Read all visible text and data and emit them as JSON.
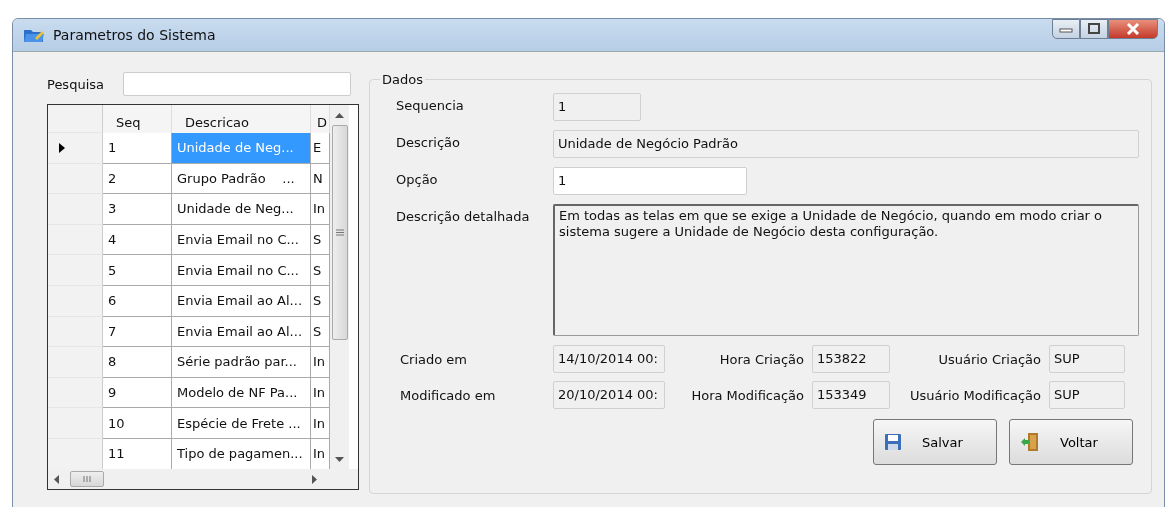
{
  "window": {
    "title": "Parametros do Sistema"
  },
  "search": {
    "label": "Pesquisa"
  },
  "grid": {
    "columns": [
      "Seq",
      "Descricao",
      "D"
    ],
    "rows": [
      {
        "seq": "1",
        "descricao": "Unidade de Neg...",
        "column_3": "E",
        "selected": true
      },
      {
        "seq": "2",
        "descricao": "Grupo Padrão    ...",
        "column_3": "N",
        "selected": false
      },
      {
        "seq": "3",
        "descricao": "Unidade de Neg...",
        "column_3": "In",
        "selected": false
      },
      {
        "seq": "4",
        "descricao": "Envia Email no C...",
        "column_3": "S",
        "selected": false
      },
      {
        "seq": "5",
        "descricao": "Envia Email no C...",
        "column_3": "S",
        "selected": false
      },
      {
        "seq": "6",
        "descricao": "Envia Email ao Al...",
        "column_3": "S",
        "selected": false
      },
      {
        "seq": "7",
        "descricao": "Envia Email ao Al...",
        "column_3": "S",
        "selected": false
      },
      {
        "seq": "8",
        "descricao": "Série padrão par...",
        "column_3": "In",
        "selected": false
      },
      {
        "seq": "9",
        "descricao": "Modelo de NF Pa...",
        "column_3": "In",
        "selected": false
      },
      {
        "seq": "10",
        "descricao": "Espécie de Frete ...",
        "column_3": "In",
        "selected": false
      },
      {
        "seq": "11",
        "descricao": "Tipo de pagamen...",
        "column_3": "In",
        "selected": false
      }
    ]
  },
  "dados": {
    "title": "Dados",
    "fields": [
      {
        "label": "Sequencia",
        "value": "1",
        "kind": "short"
      },
      {
        "label": "Descrição",
        "value": "Unidade de Negócio Padrão",
        "kind": "wide"
      },
      {
        "label": "Opção",
        "value": "1",
        "kind": "editable"
      },
      {
        "label": "Descrição detalhada",
        "value": "Em todas as telas em que se exige a Unidade de Negócio, quando em modo criar o sistema sugere a Unidade de Negócio desta configuração.",
        "kind": "multiline"
      }
    ],
    "audit": [
      {
        "label": "Criado em",
        "date": "14/10/2014 00:",
        "time_label": "Hora Criação",
        "time": "153822",
        "user_label": "Usuário Criação",
        "user": "SUP"
      },
      {
        "label": "Modificado em",
        "date": "20/10/2014 00:",
        "time_label": "Hora Modificação",
        "time": "153349",
        "user_label": "Usuário Modificação",
        "user": "SUP"
      }
    ]
  },
  "buttons": [
    {
      "label": "Salvar",
      "kind": "save"
    },
    {
      "label": "Voltar",
      "kind": "back"
    }
  ]
}
